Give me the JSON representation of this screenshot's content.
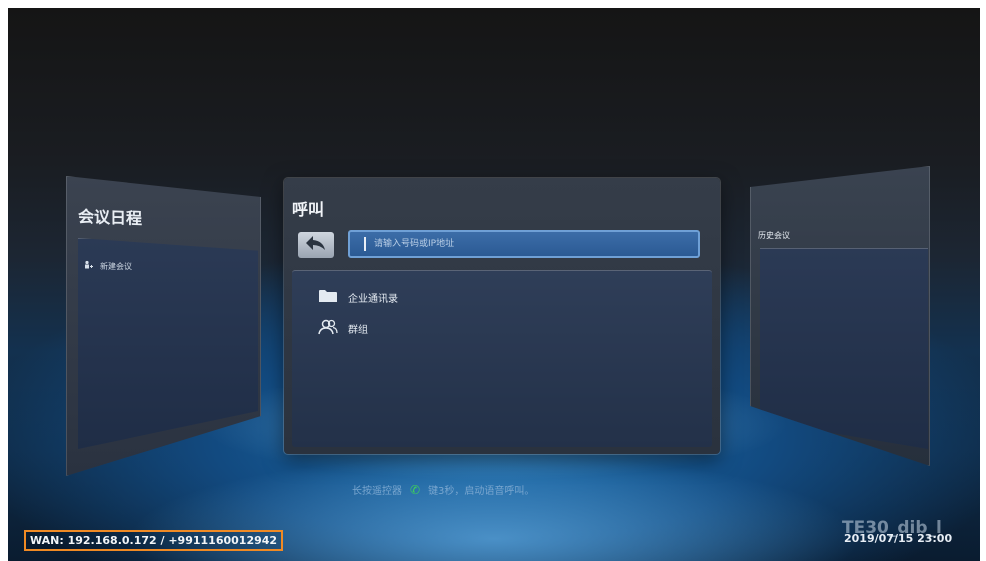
{
  "left_panel": {
    "title": "会议日程",
    "item_label": "新建会议"
  },
  "center_panel": {
    "title": "呼叫",
    "search_placeholder": "请输入号码或IP地址",
    "items": [
      {
        "label": "企业通讯录",
        "icon": "folder-icon"
      },
      {
        "label": "群组",
        "icon": "group-icon"
      }
    ]
  },
  "right_panel": {
    "title": "历史会议"
  },
  "hint": {
    "before": "长按遥控器",
    "after": "键3秒，启动语音呼叫。"
  },
  "status": {
    "wan": "WAN: 192.168.0.172 / +9911160012942",
    "model": "TE30_dib_l",
    "datetime": "2019/07/15 23:00"
  },
  "colors": {
    "accent": "#3c6da8",
    "highlight_box": "#f08a24",
    "phone_icon": "#3ecf5b"
  }
}
